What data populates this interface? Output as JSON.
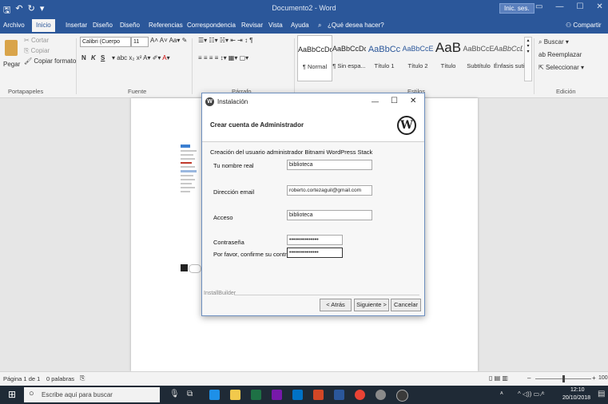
{
  "title_bar": {
    "document_title": "Documento2 - Word",
    "signin_label": "Inic. ses.",
    "qat": {
      "save": "🖫",
      "undo": "↶",
      "redo": "↻",
      "customize": "▾"
    }
  },
  "tabs": [
    {
      "label": "Archivo"
    },
    {
      "label": "Inicio"
    },
    {
      "label": "Insertar"
    },
    {
      "label": "Diseño"
    },
    {
      "label": "Diseño"
    },
    {
      "label": "Referencias"
    },
    {
      "label": "Correspondencia"
    },
    {
      "label": "Revisar"
    },
    {
      "label": "Vista"
    },
    {
      "label": "Ayuda"
    }
  ],
  "tell_me": "¿Qué desea hacer?",
  "share_label": "Compartir",
  "ribbon": {
    "clipboard": {
      "paste": "Pegar",
      "cut": "Cortar",
      "copy": "Copiar",
      "format_painter": "Copiar formato",
      "group": "Portapapeles"
    },
    "font": {
      "font_name": "Calibri (Cuerpo",
      "font_size": "11",
      "group": "Fuente",
      "bold": "N",
      "italic": "K",
      "underline": "S"
    },
    "paragraph": {
      "group": "Párrafo"
    },
    "styles": {
      "group": "Estilos",
      "items": [
        {
          "sample": "AaBbCcDc",
          "name": "¶ Normal"
        },
        {
          "sample": "AaBbCcDc",
          "name": "¶ Sin espa..."
        },
        {
          "sample": "AaBbCc",
          "name": "Título 1"
        },
        {
          "sample": "AaBbCcE",
          "name": "Título 2"
        },
        {
          "sample": "AaB",
          "name": "Título"
        },
        {
          "sample": "AaBbCcE",
          "name": "Subtítulo"
        },
        {
          "sample": "AaBbCcDc",
          "name": "Énfasis sutil"
        }
      ]
    },
    "editing": {
      "find": "Buscar",
      "replace": "Reemplazar",
      "select": "Seleccionar",
      "group": "Edición"
    }
  },
  "dialog": {
    "title": "Instalación",
    "heading": "Crear cuenta de Administrador",
    "description": "Creación del usuario administrador Bitnami WordPress Stack",
    "fields": {
      "real_name": {
        "label": "Tu nombre real",
        "value": "biblioteca"
      },
      "email": {
        "label": "Dirección email",
        "value": "roberto.cortezaguil@gmail.com"
      },
      "login": {
        "label": "Acceso",
        "value": "biblioteca"
      },
      "password": {
        "label": "Contraseña",
        "value": "•••••••••••••••"
      },
      "confirm": {
        "label": "Por favor, confirme su contraseña",
        "value": "•••••••••••••••"
      }
    },
    "footer_brand": "InstallBuilder",
    "buttons": {
      "back": "< Atrás",
      "next": "Siguiente >",
      "cancel": "Cancelar"
    },
    "window_controls": {
      "minimize": "—",
      "maximize": "☐",
      "close": "✕"
    }
  },
  "status_bar": {
    "page": "Página 1 de 1",
    "words": "0 palabras",
    "zoom": "100"
  },
  "taskbar": {
    "search_placeholder": "Escribe aquí para buscar",
    "time": "12:10",
    "date": "20/10/2018"
  }
}
